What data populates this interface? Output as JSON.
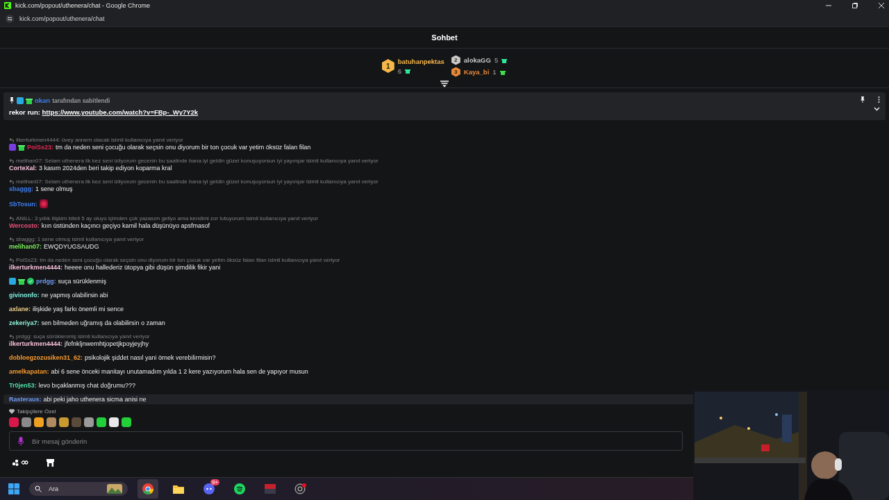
{
  "window": {
    "title": "kick.com/popout/uthenera/chat - Google Chrome",
    "url": "kick.com/popout/uthenera/chat"
  },
  "chat_title": "Sohbet",
  "leaderboard": [
    {
      "rank": "1",
      "name": "batuhanpektas",
      "count": "6",
      "color": "#f5b74a"
    },
    {
      "rank": "2",
      "name": "alokaGG",
      "count": "5",
      "color": "#c9c9c9"
    },
    {
      "rank": "3",
      "name": "Kaya_bi",
      "count": "1",
      "color": "#e8883a"
    }
  ],
  "pinned": {
    "badges": [
      {
        "kind": "og"
      },
      {
        "kind": "gifter"
      }
    ],
    "user": "okan",
    "color": "#3d7ef0",
    "note": "tarafından sabitlendi",
    "label": "rekor run:",
    "link": "https://www.youtube.com/watch?v=FBp-_Wy7Y2k"
  },
  "messages": [
    {
      "reply": "ilkerturkmen4444: üvey annem olacak isimli kullanıcıya yanıt veriyor",
      "badges": [
        {
          "kind": "subscriber"
        },
        {
          "kind": "gifter"
        }
      ],
      "user": "PoiSs23:",
      "color": "#e0284f",
      "text": "tm da neden seni çocuğu olarak seçsin onu diyorum bir ton çocuk var yetim öksüz falan filan",
      "highlighted": false
    },
    {
      "reply": "melihan07: Selam uthenera ilk kez seni izliyorum gecenin bu saatinde bana iyi geldin güzel konuşuyorsun iyi yayınşar isimli kullanıcıya yanıt veriyor",
      "user": "CorteXal:",
      "color": "#f7c1d9",
      "text": "3 kasım 2024den beri takip ediyon koparma kral",
      "highlighted": false
    },
    {
      "reply": "melihan07: Selam uthenera ilk kez seni izliyorum gecenin bu saatinde bana iyi geldin güzel konuşuyorsun iyi yayınşar isimli kullanıcıya yanıt veriyor",
      "user": "sbaggg:",
      "color": "#3d7ef0",
      "text": "1 sene olmuş",
      "highlighted": false
    },
    {
      "user": "SbTosun:",
      "color": "#3d7ef0",
      "kind": "emote",
      "highlighted": false
    },
    {
      "reply": "ANILL: 3 yıllık ilişkim biteli 5 ay oluyo içimden çok yazasım geliyo ama kendimi zor tutuyorum isimli kullanıcıya yanıt veriyor",
      "user": "Wercosto:",
      "color": "#ea4f7a",
      "text": "kıın üstünden kaçıncı geçiyo kamil hala düşünüyo apsfmasof",
      "highlighted": false
    },
    {
      "reply": "sbaggg: 1 sene olmuş isimli kullanıcıya yanıt veriyor",
      "user": "melihan07:",
      "color": "#7cf35a",
      "text": "EWQDYUGSAUDG",
      "highlighted": false
    },
    {
      "reply": "PoiSs23: tm da neden seni çocuğu olarak seçsin onu diyorum bir ton çocuk var yetim öksüz falan filan isimli kullanıcıya yanıt veriyor",
      "user": "ilkerturkmen4444:",
      "color": "#f7c1d9",
      "text": "heeee onu hallederiz ütopya gibi düşün şimdilik fikir yani",
      "highlighted": false
    },
    {
      "badges": [
        {
          "kind": "og"
        },
        {
          "kind": "gifter"
        },
        {
          "kind": "verified"
        }
      ],
      "user": "prdgg:",
      "color": "#6f9df5",
      "text": "suça sürüklenmiş",
      "highlighted": false
    },
    {
      "user": "givinonfo:",
      "color": "#7ef0e0",
      "text": "ne yapmış olabilirsin abi",
      "highlighted": false
    },
    {
      "user": "axlane:",
      "color": "#f2d38a",
      "text": "ilişkide yaş farkı önemli mi sence",
      "highlighted": false
    },
    {
      "user": "zekeriya7:",
      "color": "#8ef2d8",
      "text": "sen bilmeden uğramış da olabilirsin o zaman",
      "highlighted": false
    },
    {
      "reply": "prdgg: suça sürüklenmiş  isimli kullanıcıya yanıt veriyor",
      "user": "ilkerturkmen4444:",
      "color": "#f7c1d9",
      "text": "jfefnkljnwernhtjopetjkpoyjeyjhy",
      "highlighted": false
    },
    {
      "user": "dobloegzozusiken31_62:",
      "color": "#f59a2e",
      "text": "psikolojik şiddet nasıl yani örnek verebilirmisin?",
      "highlighted": false
    },
    {
      "user": "amelkapatan:",
      "color": "#f59a2e",
      "text": "abi 6 sene önceki manitayı unutamadım yılda 1 2 kere yazıyorum hala sen de yapıyor musun",
      "highlighted": false
    },
    {
      "user": "Tr0jen53:",
      "color": "#4fe0a8",
      "text": "levo bıçaklanmış chat doğrumu???",
      "highlighted": false
    },
    {
      "user": "Rasteraus:",
      "color": "#6f9df5",
      "text": "abi peki jaho uthenera sicma anisi ne",
      "highlighted": true
    }
  ],
  "followers_only": "Takipçilere Özel",
  "emotes": [
    {
      "color": "#d8184a"
    },
    {
      "color": "#8a8a8a"
    },
    {
      "color": "#f0a020"
    },
    {
      "color": "#b08a60"
    },
    {
      "color": "#c89a30"
    },
    {
      "color": "#5a4a3a"
    },
    {
      "color": "#9a9a9a"
    },
    {
      "color": "#22d03a"
    },
    {
      "color": "#e8e8e8"
    },
    {
      "color": "#22d03a"
    }
  ],
  "input": {
    "placeholder": "Bir mesaj gönderin"
  },
  "taskbar": {
    "search_placeholder": "Ara",
    "discord_badge": "9+",
    "apps": [
      {
        "kind": "chrome",
        "selected": true
      },
      {
        "kind": "files",
        "selected": false
      },
      {
        "kind": "discord",
        "selected": false
      },
      {
        "kind": "spotify",
        "selected": false
      },
      {
        "kind": "voicemeeter",
        "selected": false
      },
      {
        "kind": "obs",
        "selected": false
      }
    ]
  }
}
